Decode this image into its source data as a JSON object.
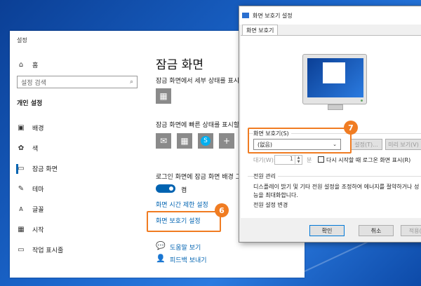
{
  "settings": {
    "title": "설정",
    "search_placeholder": "설정 검색",
    "section_header": "개인 설정",
    "nav": [
      {
        "label": "홈",
        "icon": "home-icon"
      },
      {
        "label": "배경",
        "icon": "image-icon"
      },
      {
        "label": "색",
        "icon": "palette-icon"
      },
      {
        "label": "잠금 화면",
        "icon": "lock-screen-icon"
      },
      {
        "label": "테마",
        "icon": "theme-icon"
      },
      {
        "label": "글꼴",
        "icon": "font-icon"
      },
      {
        "label": "시작",
        "icon": "start-icon"
      },
      {
        "label": "작업 표시줄",
        "icon": "taskbar-icon"
      }
    ],
    "page_title": "잠금 화면",
    "detail_text": "잠금 화면에서 세부 상태를 표시",
    "quick_text": "잠금 화면에 빠른 상태를 표시할",
    "bg_text": "로그인 화면에 잠금 화면 배경 그",
    "toggle_label": "켬",
    "timeout_link": "화면 시간 제한 설정",
    "screensaver_link": "화면 보호기 설정",
    "help_link": "도움말 보기",
    "feedback_link": "피드백 보내기"
  },
  "callouts": {
    "step6": "6",
    "step7": "7",
    "accent": "#f07c22"
  },
  "dialog": {
    "title": "화면 보호기 설정",
    "tab": "화면 보호기",
    "saver_group": "화면 보호기(S)",
    "saver_value": "(없음)",
    "settings_btn": "설정(T)...",
    "preview_btn": "미리 보기(V)",
    "wait_label": "대기(W):",
    "wait_value": "1",
    "minutes": "분",
    "resume_label": "다시 시작할 때 로그온 화면 표시(R)",
    "power_group": "전원 관리",
    "power_text_1": "디스플레이 밝기 및 기타 전원 설정을 조정하여 에너지를 절약하거나 성",
    "power_text_2": "능을 최대화합니다.",
    "power_link": "전원 설정 변경",
    "ok": "확인",
    "cancel": "취소",
    "apply": "적용(A)"
  },
  "colors": {
    "accent_blue": "#0063b1",
    "desktop": "#1456b8"
  }
}
